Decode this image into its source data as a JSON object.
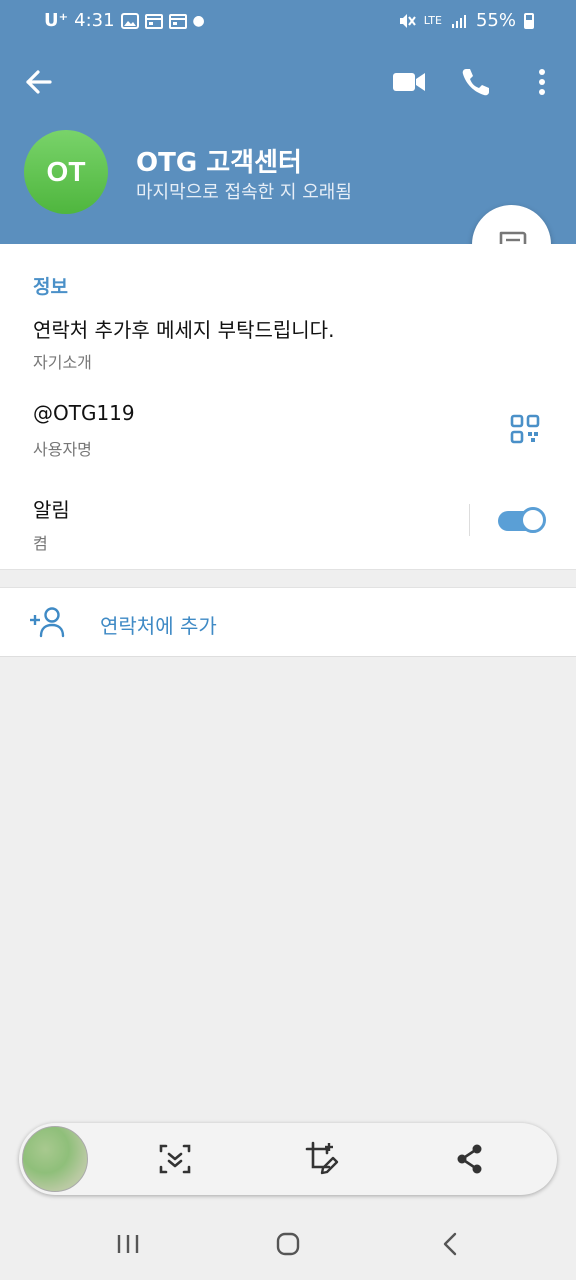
{
  "status_bar": {
    "carrier": "U⁺",
    "time": "4:31",
    "network": "LTE",
    "battery": "55%"
  },
  "app_bar": {
    "back_icon": "arrow-left-icon",
    "video_icon": "video-camera-icon",
    "call_icon": "phone-icon",
    "more_icon": "more-vertical-icon"
  },
  "profile": {
    "initials": "OT",
    "name": "OTG 고객센터",
    "status": "마지막으로 접속한 지 오래됨",
    "avatar_color": "#5cc14a",
    "header_color": "#5b8fbe"
  },
  "info": {
    "section_title": "정보",
    "bio": "연락처 추가후 메세지 부탁드립니다.",
    "bio_label": "자기소개",
    "username": "@OTG119",
    "username_label": "사용자명",
    "notifications": "알림",
    "notifications_state": "켬"
  },
  "add_contact": {
    "label": "연락처에 추가"
  },
  "screenshot_toolbar": {
    "icons": [
      "scroll-capture-icon",
      "crop-edit-icon",
      "share-icon"
    ]
  },
  "nav": {
    "icons": [
      "recent-apps-icon",
      "home-icon",
      "back-icon"
    ]
  },
  "colors": {
    "accent": "#4a90c8",
    "toggle_on": "#5a9fd6"
  }
}
